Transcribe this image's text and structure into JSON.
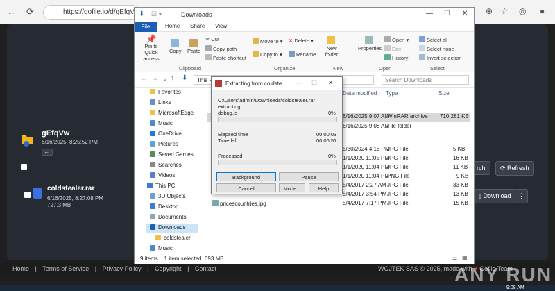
{
  "browser": {
    "url": "https://gofile.io/d/gEfqVw",
    "back": "←",
    "forward": "→",
    "reload": "⟳"
  },
  "gofile": {
    "folder_name": "gEfqVw",
    "folder_date": "6/16/2025, 8:25:52 PM",
    "more_label": "...",
    "search_btn": "rch",
    "refresh_btn": "Refresh",
    "file_name": "coldstealer.rar",
    "file_date": "6/16/2025, 8:27:08 PM",
    "file_size": "727.3 MB",
    "download_btn": "Download",
    "footer_links": [
      "Home",
      "|",
      "Terms of Service",
      "|",
      "Privacy Policy",
      "|",
      "Copyright",
      "|",
      "Contact"
    ],
    "footer_right": "WOJTEK SAS © 2025, made with",
    "footer_team": "Gofile Team",
    "watermark": "ANY RUN",
    "clock": "9:08 AM"
  },
  "explorer": {
    "title": "Downloads",
    "tabs": [
      "File",
      "Home",
      "Share",
      "View"
    ],
    "ribbon": {
      "pin": "Pin to Quick access",
      "copy": "Copy",
      "paste": "Paste",
      "cut": "Cut",
      "copy_path": "Copy path",
      "paste_shortcut": "Paste shortcut",
      "move_to": "Move to",
      "copy_to": "Copy to",
      "delete": "Delete",
      "rename": "Rename",
      "new_folder": "New folder",
      "properties": "Properties",
      "open": "Open",
      "edit": "Edit",
      "history": "History",
      "select_all": "Select all",
      "select_none": "Select none",
      "invert_selection": "Invert selection",
      "groups": [
        "Clipboard",
        "Organize",
        "New",
        "Open",
        "Select"
      ]
    },
    "address": "This PC › Downloads",
    "search_placeholder": "Search Downloads",
    "columns": [
      "Date modified",
      "Type",
      "Size"
    ],
    "nav_items": [
      "Favorites",
      "Links",
      "MicrosoftEdge",
      "Music",
      "OneDrive",
      "Pictures",
      "Saved Games",
      "Searches",
      "Videos",
      "This PC",
      "3D Objects",
      "Desktop",
      "Documents",
      "Downloads",
      "coldstealer",
      "Music"
    ],
    "rows": [
      {
        "date": "6/16/2025 9:07 AM",
        "type": "WinRAR archive",
        "size": "710,281 KB"
      },
      {
        "date": "6/16/2025 9:08 AM",
        "type": "File folder",
        "size": ""
      },
      {
        "date": "5/30/2024 4:18 PM",
        "type": "JPG File",
        "size": "5 KB"
      },
      {
        "date": "1/1/2020 11:05 PM",
        "type": "JPG File",
        "size": "16 KB"
      },
      {
        "date": "1/1/2020 11:04 PM",
        "type": "JPG File",
        "size": "11 KB"
      },
      {
        "date": "1/1/2020 11:04 PM",
        "type": "PNG File",
        "size": "9 KB"
      },
      {
        "date": "5/4/2017 2:27 AM",
        "type": "JPG File",
        "size": "33 KB"
      },
      {
        "date": "5/4/2017 3:54 PM",
        "type": "JPG File",
        "size": "13 KB"
      },
      {
        "name": "pricescountries.jpg",
        "date": "5/4/2017 7:17 PM",
        "type": "JPG File",
        "size": "15 KB"
      }
    ],
    "status": "9 items    1 item selected  693 MB"
  },
  "dialog": {
    "title": "Extracting from coldste...",
    "path": "C:\\Users\\admin\\Downloads\\coldstealer.rar",
    "action": "extracting",
    "current_file": "debug.js",
    "file_pct": "0%",
    "elapsed_label": "Elapsed time",
    "elapsed": "00:00:03",
    "left_label": "Time left",
    "left": "00:06:51",
    "processed_label": "Processed",
    "processed_pct": "0%",
    "buttons": [
      "Background",
      "Pause",
      "Cancel",
      "Mode...",
      "Help"
    ]
  }
}
